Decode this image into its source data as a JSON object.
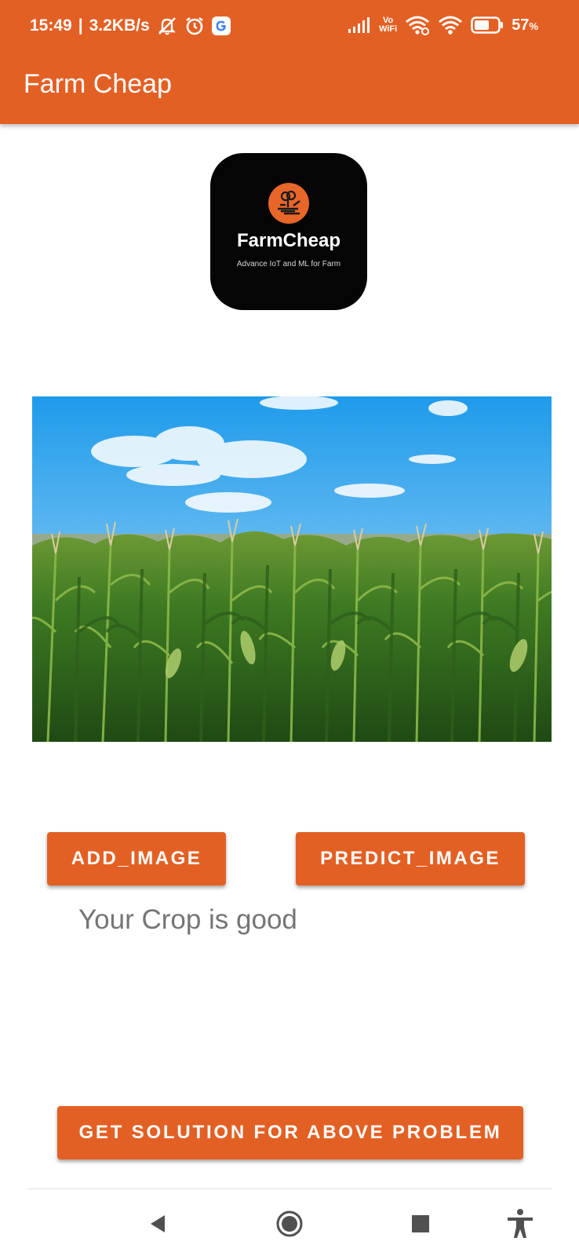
{
  "status_bar": {
    "time": "15:49",
    "net_speed": "3.2KB/s",
    "vowifi_line1": "Vo",
    "vowifi_line2": "WiFi",
    "battery_percent": "57",
    "battery_unit": "%",
    "icons": [
      "mute-icon",
      "alarm-icon",
      "google-icon",
      "signal-icon",
      "vowifi-icon",
      "wifi-icon",
      "wifi-icon",
      "battery-icon"
    ]
  },
  "app_bar": {
    "title": "Farm Cheap",
    "color": "#E36024"
  },
  "logo": {
    "name": "FarmCheap",
    "tagline": "Advance IoT and ML for Farm"
  },
  "photo": {
    "description_icon": "corn-field-image"
  },
  "buttons": {
    "add_image": "ADD_IMAGE",
    "predict_image": "PREDICT_IMAGE",
    "get_solution": "GET SOLUTION FOR ABOVE PROBLEM"
  },
  "result": {
    "text": "Your Crop is good"
  },
  "nav_bar": {
    "icons": [
      "back-icon",
      "home-icon",
      "recents-icon",
      "accessibility-icon"
    ]
  }
}
